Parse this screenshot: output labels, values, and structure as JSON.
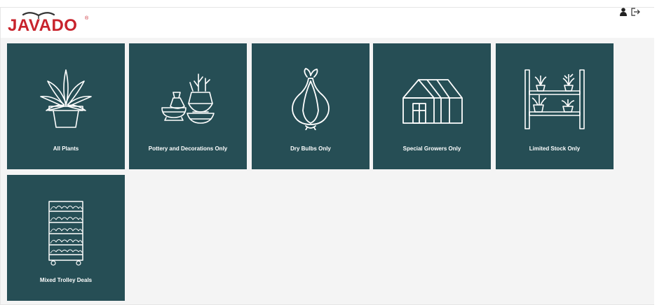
{
  "brand": {
    "name": "JAVADO",
    "registered_mark": "®",
    "color": "#c8232c"
  },
  "header": {
    "icons": [
      "user-icon",
      "logout-icon"
    ]
  },
  "tile_color": "#264e55",
  "categories": [
    {
      "label": "All Plants",
      "icon": "potted-plant-icon"
    },
    {
      "label": "Pottery and Decorations Only",
      "icon": "pottery-vases-icon"
    },
    {
      "label": "Dry Bulbs Only",
      "icon": "onion-bulb-icon"
    },
    {
      "label": "Special Growers Only",
      "icon": "greenhouse-icon"
    },
    {
      "label": "Limited Stock Only",
      "icon": "plant-shelf-icon"
    },
    {
      "label": "Mixed Trolley Deals",
      "icon": "plant-trolley-icon"
    }
  ]
}
